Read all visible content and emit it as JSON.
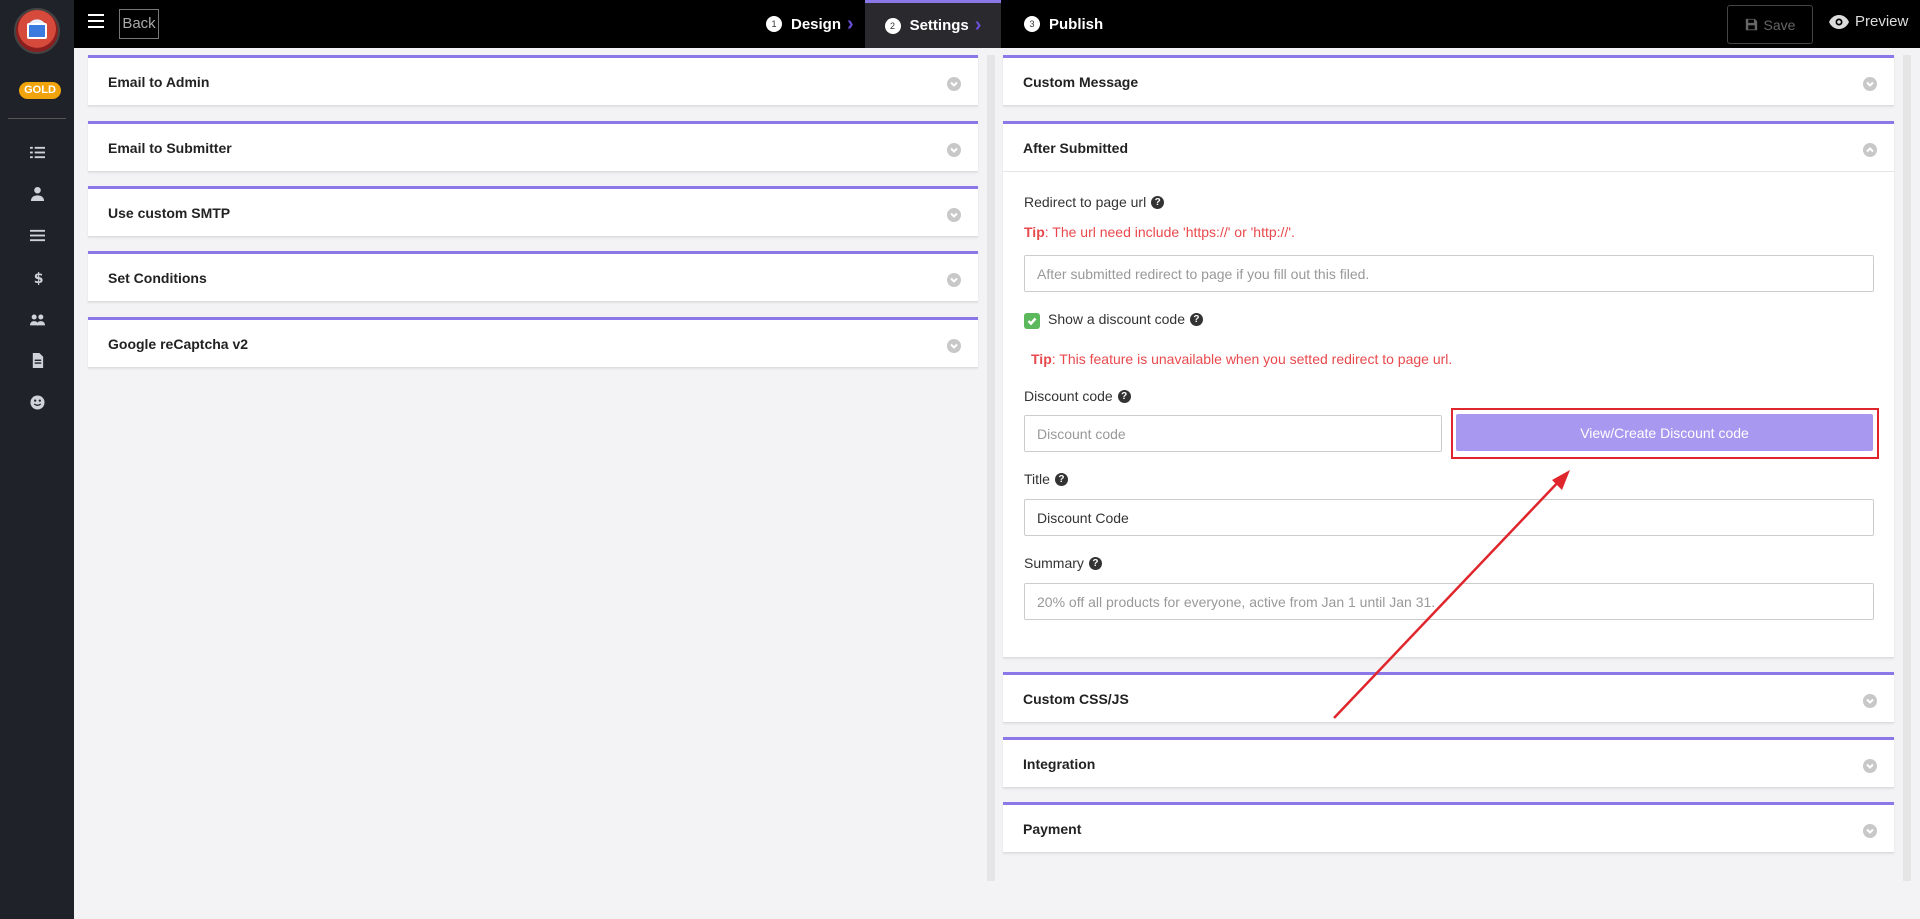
{
  "sidebar": {
    "badge": "GOLD",
    "icons": [
      "list-icon",
      "user-icon",
      "menu-lines-icon",
      "dollar-icon",
      "users-icon",
      "document-icon",
      "smile-icon"
    ]
  },
  "topbar": {
    "back_label": "Back",
    "steps": [
      {
        "num": "1",
        "label": "Design"
      },
      {
        "num": "2",
        "label": "Settings"
      },
      {
        "num": "3",
        "label": "Publish"
      }
    ],
    "save_label": "Save",
    "preview_label": "Preview"
  },
  "left_panels": [
    {
      "title": "Email to Admin"
    },
    {
      "title": "Email to Submitter"
    },
    {
      "title": "Use custom SMTP"
    },
    {
      "title": "Set Conditions"
    },
    {
      "title": "Google reCaptcha v2"
    }
  ],
  "right_panels": {
    "custom_message": "Custom Message",
    "after_submitted": "After Submitted",
    "custom_css_js": "Custom CSS/JS",
    "integration": "Integration",
    "payment": "Payment"
  },
  "after_submitted": {
    "redirect_label": "Redirect to page url",
    "tip1_prefix": "Tip",
    "tip1_text": ": The url need include 'https://' or 'http://'.",
    "redirect_placeholder": "After submitted redirect to page if you fill out this filed.",
    "show_discount_label": "Show a discount code",
    "tip2_prefix": "Tip",
    "tip2_text": ": This feature is unavailable when you setted redirect to page url.",
    "discount_code_label": "Discount code",
    "discount_code_placeholder": "Discount code",
    "view_create_button": "View/Create Discount code",
    "title_label": "Title",
    "title_value": "Discount Code",
    "summary_label": "Summary",
    "summary_placeholder": "20% off all products for everyone, active from Jan 1 until Jan 31."
  }
}
